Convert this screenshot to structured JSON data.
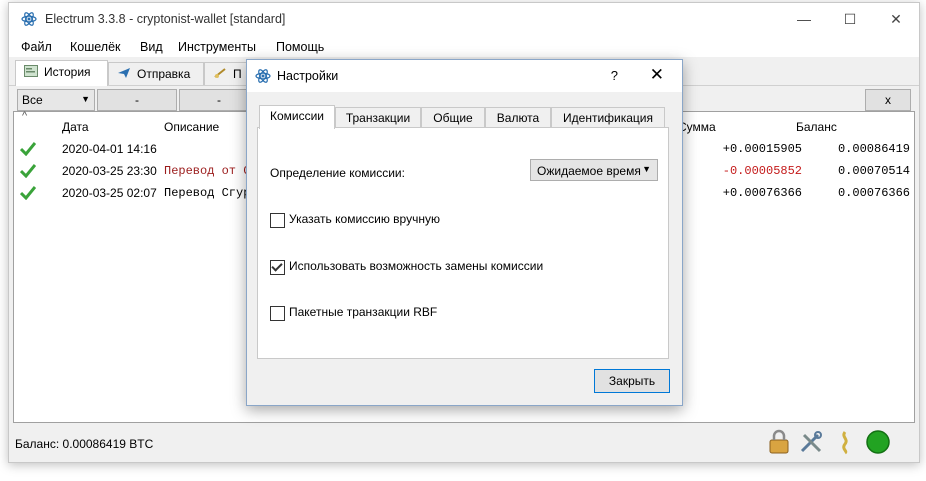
{
  "window": {
    "title": "Electrum 3.3.8  -  cryptonist-wallet  [standard]",
    "min_icon": "minimize-icon",
    "max_icon": "maximize-icon",
    "close_icon": "close-icon"
  },
  "menu": [
    "Файл",
    "Кошелёк",
    "Вид",
    "Инструменты",
    "Помощь"
  ],
  "tabs": [
    {
      "label": "История",
      "icon": "history-icon"
    },
    {
      "label": "Отправка",
      "icon": "send-icon"
    },
    {
      "label": "П",
      "icon": "receive-icon"
    }
  ],
  "filter": {
    "selected": "Все",
    "btn1": "-",
    "btn2": "-",
    "clear": "x"
  },
  "history": {
    "headers": {
      "date": "Дата",
      "description": "Описание",
      "amount": "Сумма",
      "balance": "Баланс"
    },
    "rows": [
      {
        "date": "2020-04-01 14:16",
        "description": "",
        "amount": "+0.00015905",
        "balance": "0.00086419"
      },
      {
        "date": "2020-03-25 23:30",
        "description": "Перевод от С",
        "amount": "-0.00005852",
        "balance": "0.00070514"
      },
      {
        "date": "2020-03-25 02:07",
        "description": "Перевод Сгур",
        "amount": "+0.00076366",
        "balance": "0.00076366"
      }
    ],
    "sort_indicator": "^"
  },
  "status": {
    "balance_text": "Баланс: 0.00086419 BTC"
  },
  "colors": {
    "negative": "#c41a1a",
    "accent": "#0078d7",
    "online": "#22a322"
  },
  "dialog": {
    "title": "Настройки",
    "help": "?",
    "close": "✕",
    "tabs": [
      "Комиссии",
      "Транзакции",
      "Общие",
      "Валюта",
      "Идентификация"
    ],
    "fee_label": "Определение комиссии:",
    "fee_value": "Ожидаемое время",
    "options": [
      {
        "label": "Указать комиссию вручную",
        "checked": false
      },
      {
        "label": "Использовать возможность замены комиссии",
        "checked": true
      },
      {
        "label": "Пакетные транзакции RBF",
        "checked": false
      }
    ],
    "close_button": "Закрыть"
  }
}
